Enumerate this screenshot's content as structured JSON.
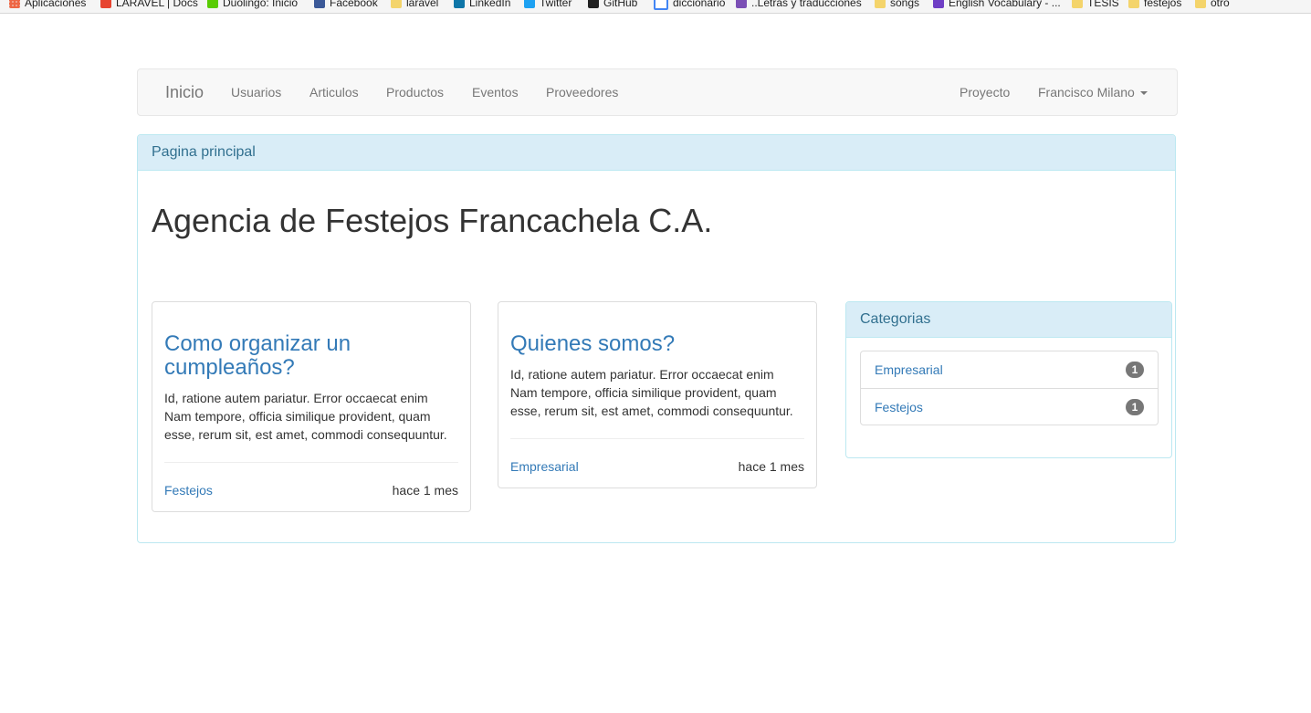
{
  "bookmarks": [
    {
      "label": "Aplicaciones",
      "icon": "apps-icon"
    },
    {
      "label": "LARAVEL | Docs",
      "icon": "laravel-icon"
    },
    {
      "label": "Duolingo: Inicio",
      "icon": "duolingo-icon"
    },
    {
      "label": "Facebook",
      "icon": "facebook-icon"
    },
    {
      "label": "laravel",
      "icon": "folder-icon"
    },
    {
      "label": "LinkedIn",
      "icon": "linkedin-icon"
    },
    {
      "label": "Twitter",
      "icon": "twitter-icon"
    },
    {
      "label": "GitHub",
      "icon": "github-icon"
    },
    {
      "label": "diccionario",
      "icon": "google-icon"
    },
    {
      "label": "..Letras y traducciones",
      "icon": "lyrics-icon"
    },
    {
      "label": "songs",
      "icon": "folder-icon"
    },
    {
      "label": "English Vocabulary - ...",
      "icon": "vocabulary-icon"
    },
    {
      "label": "TESIS",
      "icon": "folder-icon"
    },
    {
      "label": "festejos",
      "icon": "folder-icon"
    },
    {
      "label": "otro",
      "icon": "folder-icon"
    }
  ],
  "navbar": {
    "brand": "Inicio",
    "links": [
      "Usuarios",
      "Articulos",
      "Productos",
      "Eventos",
      "Proveedores"
    ],
    "right_link": "Proyecto",
    "user": "Francisco Milano"
  },
  "main": {
    "panel_title": "Pagina principal",
    "page_title": "Agencia de Festejos Francachela C.A."
  },
  "articles": [
    {
      "title_line1": "Como organizar un",
      "title_line2": "cumpleaños?",
      "body_line1": "Id, ratione autem pariatur. Error occaecat enim",
      "body_line2": "Nam tempore, officia similique provident, quam",
      "body_line3": "esse, rerum sit, est amet, commodi consequuntur.",
      "category": "Festejos",
      "time": "hace 1 mes"
    },
    {
      "title_line1": "Quienes somos?",
      "body_line1": "Id, ratione autem pariatur. Error occaecat enim",
      "body_line2": "Nam tempore, officia similique provident, quam",
      "body_line3": "esse, rerum sit, est amet, commodi consequuntur.",
      "category": "Empresarial",
      "time": "hace 1 mes"
    }
  ],
  "categories": {
    "title": "Categorias",
    "items": [
      {
        "label": "Empresarial",
        "count": "1"
      },
      {
        "label": "Festejos",
        "count": "1"
      }
    ]
  },
  "colors": {
    "link": "#337ab7",
    "panel_info_bg": "#d9edf7",
    "panel_info_text": "#31708f",
    "badge": "#777777"
  }
}
